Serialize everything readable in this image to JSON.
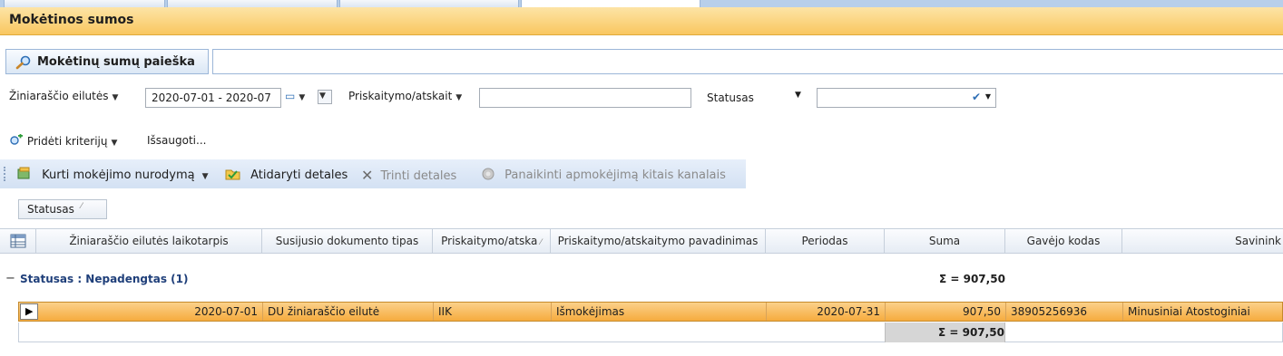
{
  "window": {
    "title": "Mokėtinos sumos"
  },
  "search": {
    "title": "Mokėtinų sumų paieška",
    "query": ""
  },
  "filters": {
    "period_label": "Žiniaraščio eilutės",
    "period_value": "2020-07-01 - 2020-07",
    "accrual_label": "Priskaitymo/atskait",
    "accrual_value": "",
    "status_label": "Statusas",
    "status_value": ""
  },
  "criteria": {
    "add_label": "Pridėti kriterijų",
    "saved_label": "Išsaugoti..."
  },
  "toolbar": {
    "create_order": "Kurti mokėjimo nurodymą",
    "open_details": "Atidaryti detales",
    "delete_details": "Trinti detales",
    "cancel_payment": "Panaikinti apmokėjimą kitais kanalais"
  },
  "grouping": {
    "chip_label": "Statusas"
  },
  "grid": {
    "columns": [
      "Žiniaraščio eilutės laikotarpis",
      "Susijusio dokumento tipas",
      "Priskaitymo/atska",
      "Priskaitymo/atskaitymo pavadinimas",
      "Periodas",
      "Suma",
      "Gavėjo kodas",
      "Savinink"
    ],
    "group": {
      "label": "Statusas : Nepadengtas (1)",
      "sum": "Σ = 907,50"
    },
    "rows": [
      {
        "period": "2020-07-01",
        "doc_type": "DU žiniaraščio eilutė",
        "accrual_code": "IIK",
        "accrual_name": "Išmokėjimas",
        "periodas": "2020-07-31",
        "suma": "907,50",
        "recipient_code": "38905256936",
        "owner": "Minusiniai Atostoginiai"
      }
    ],
    "footer_sum": "Σ = 907,50"
  },
  "colors": {
    "title_bar": "#f9c760",
    "selected_row": "#f6ab3e",
    "toolbar_bg": "#dce7f5",
    "group_text": "#1f3f7a"
  }
}
